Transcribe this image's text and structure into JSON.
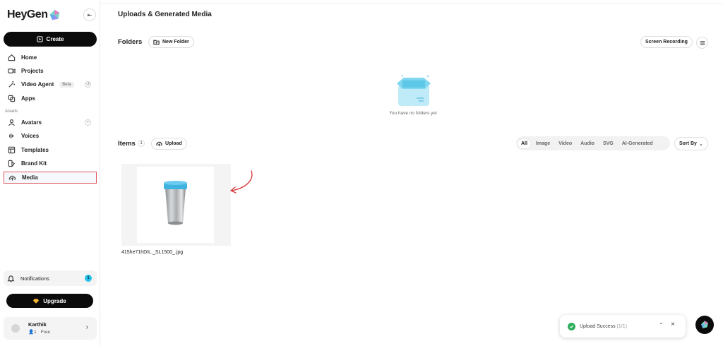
{
  "sidebar": {
    "brand": "HeyGen",
    "create_label": "Create",
    "nav": [
      {
        "label": "Home",
        "icon": "home-icon"
      },
      {
        "label": "Projects",
        "icon": "video-icon"
      },
      {
        "label": "Video Agent",
        "icon": "wand-icon",
        "badge": "Beta"
      },
      {
        "label": "Apps",
        "icon": "apps-icon"
      }
    ],
    "section_label": "Assets",
    "assets": [
      {
        "label": "Avatars",
        "icon": "avatar-icon"
      },
      {
        "label": "Voices",
        "icon": "waveform-icon"
      },
      {
        "label": "Templates",
        "icon": "template-icon"
      },
      {
        "label": "Brand Kit",
        "icon": "brandkit-icon"
      },
      {
        "label": "Media",
        "icon": "upload-cloud-icon",
        "active": true
      }
    ],
    "notifications_label": "Notifications",
    "notifications_count": "1",
    "upgrade_label": "Upgrade",
    "user": {
      "name": "Karthik",
      "seats": "1",
      "plan": "Free"
    }
  },
  "main": {
    "title": "Uploads & Generated Media",
    "folders_label": "Folders",
    "new_folder_label": "New Folder",
    "screen_recording_label": "Screen Recording",
    "empty_text": "You have no folders yet",
    "items_label": "Items",
    "items_count": "1",
    "upload_label": "Upload",
    "filters": [
      "All",
      "Image",
      "Video",
      "Audio",
      "SVG",
      "AI-Generated"
    ],
    "active_filter": "All",
    "sort_label": "Sort By",
    "media": [
      {
        "name": "415he71hDIL._SL1500_.jpg"
      }
    ]
  },
  "toast": {
    "text": "Upload Success",
    "count": "(1/1)"
  },
  "colors": {
    "accent": "#25c1e8",
    "active_border": "#e05660",
    "success": "#2fae5b"
  }
}
